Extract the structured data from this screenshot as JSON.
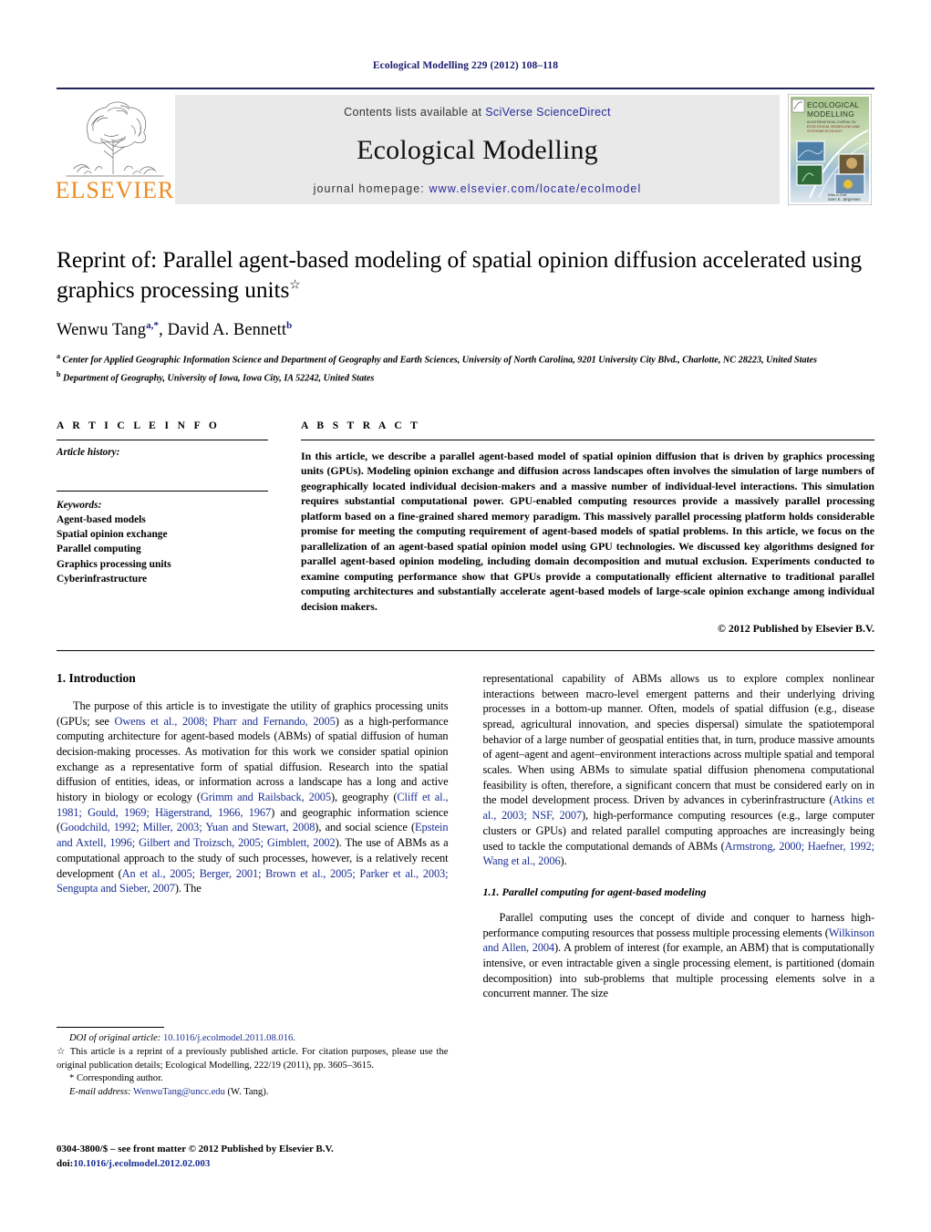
{
  "running_head": "Ecological Modelling 229 (2012) 108–118",
  "masthead": {
    "publisher": "ELSEVIER",
    "contents_prefix": "Contents lists available at ",
    "contents_link": "SciVerse ScienceDirect",
    "journal_title": "Ecological Modelling",
    "homepage_prefix": "journal homepage: ",
    "homepage_url": "www.elsevier.com/locate/ecolmodel",
    "cover": {
      "line1": "ECOLOGICAL",
      "line2": "MODELLING",
      "sub1": "AN INTERNATIONAL JOURNAL ON",
      "sub2": "ECOLOGICAL MODELLING AND",
      "sub3": "SYSTEMS ECOLOGY",
      "footer1": "Editor-in-Chief",
      "footer2": "Sven E. Jørgensen"
    },
    "colors": {
      "elsevier_orange": "#ED8B22",
      "link_blue": "#2a2a9c",
      "masthead_bg": "#e9e9e9",
      "rule": "#23235c"
    }
  },
  "title": {
    "text": "Reprint of: Parallel agent-based modeling of spatial opinion diffusion accelerated using graphics processing units",
    "footnote_marker": "☆"
  },
  "authors": {
    "list": [
      {
        "name": "Wenwu Tang",
        "sup": "a,*"
      },
      {
        "name": "David A. Bennett",
        "sup": "b"
      }
    ],
    "full_line": "Wenwu Tang, David A. Bennett"
  },
  "affiliations": [
    {
      "label": "a",
      "text": "Center for Applied Geographic Information Science and Department of Geography and Earth Sciences, University of North Carolina, 9201 University City Blvd., Charlotte, NC 28223, United States"
    },
    {
      "label": "b",
      "text": "Department of Geography, University of Iowa, Iowa City, IA 52242, United States"
    }
  ],
  "article_info": {
    "heading": "A R T I C L E    I N F O",
    "history_label": "Article history:",
    "keywords_label": "Keywords:",
    "keywords": [
      "Agent-based models",
      "Spatial opinion exchange",
      "Parallel computing",
      "Graphics processing units",
      "Cyberinfrastructure"
    ]
  },
  "abstract": {
    "heading": "A B S T R A C T",
    "text": "In this article, we describe a parallel agent-based model of spatial opinion diffusion that is driven by graphics processing units (GPUs). Modeling opinion exchange and diffusion across landscapes often involves the simulation of large numbers of geographically located individual decision-makers and a massive number of individual-level interactions. This simulation requires substantial computational power. GPU-enabled computing resources provide a massively parallel processing platform based on a fine-grained shared memory paradigm. This massively parallel processing platform holds considerable promise for meeting the computing requirement of agent-based models of spatial problems. In this article, we focus on the parallelization of an agent-based spatial opinion model using GPU technologies. We discussed key algorithms designed for parallel agent-based opinion modeling, including domain decomposition and mutual exclusion. Experiments conducted to examine computing performance show that GPUs provide a computationally efficient alternative to traditional parallel computing architectures and substantially accelerate agent-based models of large-scale opinion exchange among individual decision makers.",
    "copyright": "© 2012 Published by Elsevier B.V."
  },
  "body": {
    "section1_heading": "1.  Introduction",
    "left_paragraph_1": [
      {
        "t": "The purpose of this article is to investigate the utility of graphics processing units (GPUs; see ",
        "c": false
      },
      {
        "t": "Owens et al., 2008; Pharr and Fernando, 2005",
        "c": true
      },
      {
        "t": ") as a high-performance computing architecture for agent-based models (ABMs) of spatial diffusion of human decision-making processes. As motivation for this work we consider spatial opinion exchange as a representative form of spatial diffusion. Research into the spatial diffusion of entities, ideas, or information across a landscape has a long and active history in biology or ecology (",
        "c": false
      },
      {
        "t": "Grimm and Railsback, 2005",
        "c": true
      },
      {
        "t": "), geography (",
        "c": false
      },
      {
        "t": "Cliff et al., 1981; Gould, 1969; Hägerstrand, 1966, 1967",
        "c": true
      },
      {
        "t": ") and geographic information science (",
        "c": false
      },
      {
        "t": "Goodchild, 1992; Miller, 2003; Yuan and Stewart, 2008",
        "c": true
      },
      {
        "t": "), and social science (",
        "c": false
      },
      {
        "t": "Epstein and Axtell, 1996; Gilbert and Troizsch, 2005; Gimblett, 2002",
        "c": true
      },
      {
        "t": "). The use of ABMs as a computational approach to the study of such processes, however, is a relatively recent development (",
        "c": false
      },
      {
        "t": "An et al., 2005; Berger, 2001; Brown et al., 2005; Parker et al., 2003; Sengupta and Sieber, 2007",
        "c": true
      },
      {
        "t": "). The",
        "c": false
      }
    ],
    "right_paragraph_1": [
      {
        "t": "representational capability of ABMs allows us to explore complex nonlinear interactions between macro-level emergent patterns and their underlying driving processes in a bottom-up manner. Often, models of spatial diffusion (e.g., disease spread, agricultural innovation, and species dispersal) simulate the spatiotemporal behavior of a large number of geospatial entities that, in turn, produce massive amounts of agent–agent and agent–environment interactions across multiple spatial and temporal scales. When using ABMs to simulate spatial diffusion phenomena computational feasibility is often, therefore, a significant concern that must be considered early on in the model development process. Driven by advances in cyberinfrastructure (",
        "c": false
      },
      {
        "t": "Atkins et al., 2003; NSF, 2007",
        "c": true
      },
      {
        "t": "), high-performance computing resources (e.g., large computer clusters or GPUs) and related parallel computing approaches are increasingly being used to tackle the computational demands of ABMs (",
        "c": false
      },
      {
        "t": "Armstrong, 2000; Haefner, 1992; Wang et al., 2006",
        "c": true
      },
      {
        "t": ").",
        "c": false
      }
    ],
    "subsection_heading": "1.1.  Parallel computing for agent-based modeling",
    "right_paragraph_2": [
      {
        "t": "Parallel computing uses the concept of divide and conquer to harness high-performance computing resources that possess multiple processing elements (",
        "c": false
      },
      {
        "t": "Wilkinson and Allen, 2004",
        "c": true
      },
      {
        "t": "). A problem of interest (for example, an ABM) that is computationally intensive, or even intractable given a single processing element, is partitioned (domain decomposition) into sub-problems that multiple processing elements solve in a concurrent manner. The size",
        "c": false
      }
    ]
  },
  "footnotes": {
    "doi_label": "DOI of original article:",
    "doi_value": "10.1016/j.ecolmodel.2011.08.016.",
    "star_marker": "☆",
    "star_text": "This article is a reprint of a previously published article. For citation purposes, please use the original publication details; Ecological Modelling, 222/19 (2011), pp. 3605–3615.",
    "corresponding_marker": "*",
    "corresponding_text": "Corresponding author.",
    "email_label": "E-mail address:",
    "email_value": "WenwuTang@uncc.edu",
    "email_suffix": "(W. Tang)."
  },
  "issn_footer": {
    "line1": "0304-3800/$ – see front matter © 2012 Published by Elsevier B.V.",
    "doi_label": "doi:",
    "doi_value": "10.1016/j.ecolmodel.2012.02.003"
  }
}
